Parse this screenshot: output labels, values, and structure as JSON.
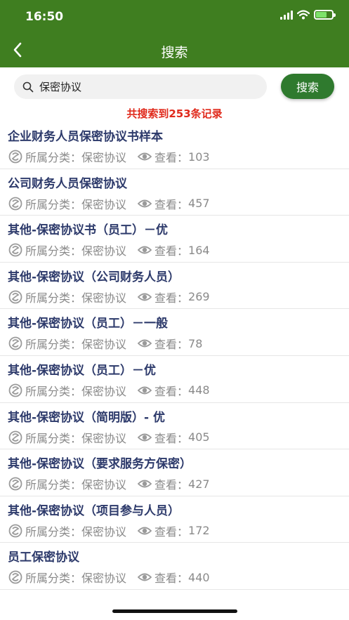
{
  "status_bar": {
    "time": "16:50"
  },
  "header": {
    "title": "搜索"
  },
  "search": {
    "value": "保密协议",
    "button_label": "搜索"
  },
  "result_summary": "共搜索到253条记录",
  "labels": {
    "category_prefix": "所属分类：",
    "views_prefix": "查看："
  },
  "colors": {
    "header_bg": "#3f7e20",
    "button_bg": "#2f7a2e",
    "count_text": "#e02a1c",
    "title_text": "#2d3a6b"
  },
  "results": [
    {
      "title": "企业财务人员保密协议书样本",
      "category": "保密协议",
      "views": "103"
    },
    {
      "title": "公司财务人员保密协议",
      "category": "保密协议",
      "views": "457"
    },
    {
      "title": "其他-保密协议书（员工）－优",
      "category": "保密协议",
      "views": "164"
    },
    {
      "title": "其他-保密协议（公司财务人员）",
      "category": "保密协议",
      "views": "269"
    },
    {
      "title": "其他-保密协议（员工）－一般",
      "category": "保密协议",
      "views": "78"
    },
    {
      "title": "其他-保密协议（员工）－优",
      "category": "保密协议",
      "views": "448"
    },
    {
      "title": "其他-保密协议（简明版）- 优",
      "category": "保密协议",
      "views": "405"
    },
    {
      "title": "其他-保密协议（要求服务方保密）",
      "category": "保密协议",
      "views": "427"
    },
    {
      "title": "其他-保密协议（项目参与人员）",
      "category": "保密协议",
      "views": "172"
    },
    {
      "title": "员工保密协议",
      "category": "保密协议",
      "views": "440"
    }
  ]
}
